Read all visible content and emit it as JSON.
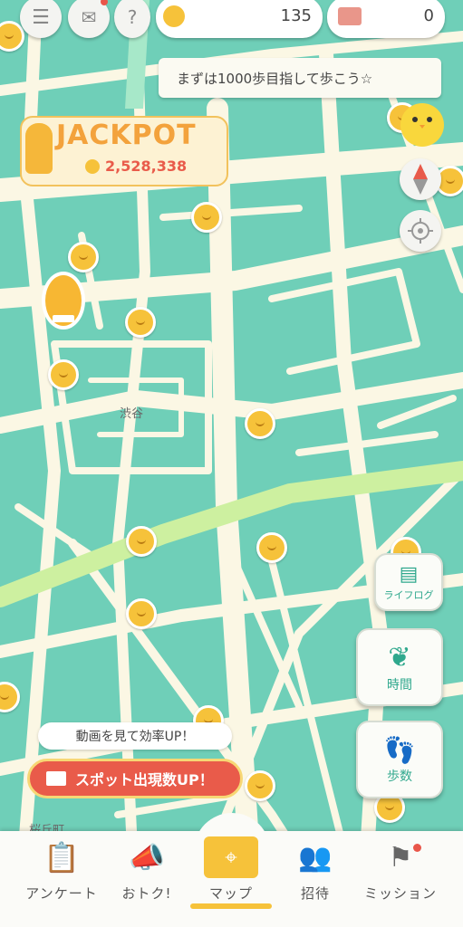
{
  "header": {
    "coins": "135",
    "tickets": "0"
  },
  "banner": {
    "message": "まずは1000歩目指して歩こう☆"
  },
  "jackpot": {
    "title": "JACKPOT",
    "amount": "2,528,338"
  },
  "map": {
    "place_labels": [
      "渋谷",
      "桜丘町"
    ]
  },
  "side_buttons": {
    "lifelog": "ライフログ",
    "time": "時間",
    "steps": "歩数"
  },
  "promo": {
    "tip": "動画を見て効率UP！",
    "button": "スポット出現数UP！"
  },
  "nav": {
    "items": [
      {
        "label": "アンケート"
      },
      {
        "label": "おトク!"
      },
      {
        "label": "マップ"
      },
      {
        "label": "招待"
      },
      {
        "label": "ミッション"
      }
    ],
    "active": "マップ"
  },
  "colors": {
    "map_water": "#6fcfb8",
    "road": "#fbf7e4",
    "park_road": "#cdf0a0",
    "accent": "#e95b4a",
    "coin": "#f6c23a",
    "icon_teal": "#2fa88d"
  }
}
